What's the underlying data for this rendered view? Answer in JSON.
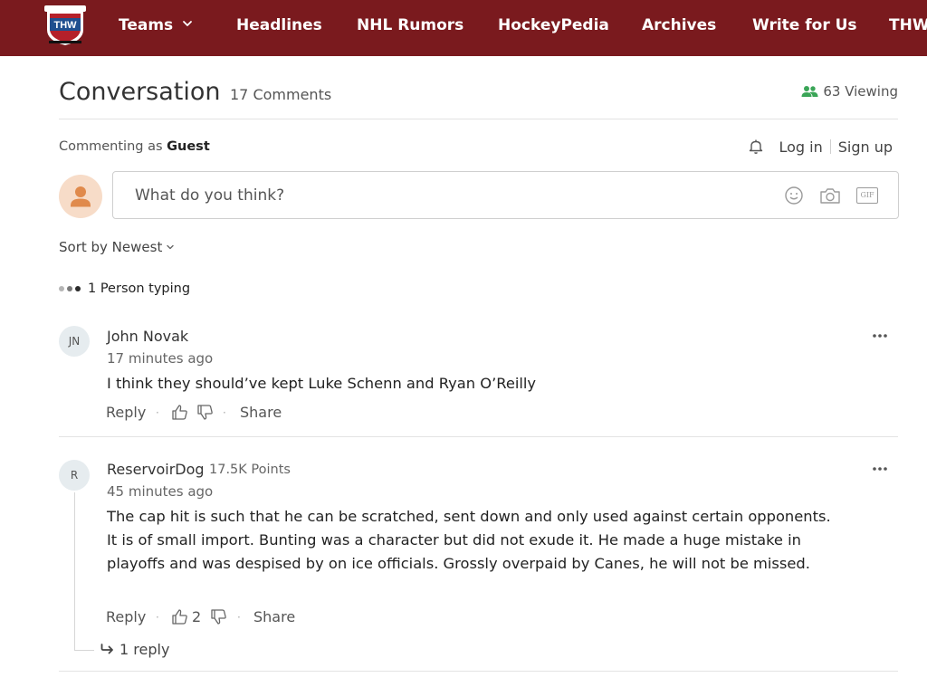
{
  "nav": {
    "items": [
      "Teams",
      "Headlines",
      "NHL Rumors",
      "HockeyPedia",
      "Archives",
      "Write for Us",
      "THW"
    ],
    "logo_text": "THW",
    "background": "#7a1a1e"
  },
  "conversation": {
    "title": "Conversation",
    "count_label": "17 Comments",
    "viewing_label": "63 Viewing"
  },
  "account": {
    "commenting_as_label": "Commenting as",
    "commenting_as_name": "Guest",
    "login_label": "Log in",
    "signup_label": "Sign up"
  },
  "composer": {
    "placeholder": "What do you think?",
    "gif_label": "GIF"
  },
  "sort": {
    "label": "Sort by Newest"
  },
  "typing": {
    "label": "1 Person typing"
  },
  "comments": [
    {
      "initials": "JN",
      "author": "John Novak",
      "points": "",
      "time": "17 minutes ago",
      "body": "I think they should’ve kept Luke Schenn and Ryan O’Reilly",
      "reply_label": "Reply",
      "share_label": "Share",
      "upvotes": ""
    },
    {
      "initials": "R",
      "author": "ReservoirDog",
      "points": "17.5K Points",
      "time": "45 minutes ago",
      "body": "The cap hit is such that he can be scratched, sent down and only used against certain opponents. It is of small import. Bunting was a character but did not exude it. He made a huge mistake in playoffs and was despised by on ice officials. Grossly overpaid by Canes, he will not be missed.",
      "reply_label": "Reply",
      "share_label": "Share",
      "upvotes": "2",
      "replies_label": "1 reply"
    }
  ],
  "icons": {
    "logo": "thw-shield-logo",
    "teams_dropdown": "chevron-down-icon",
    "viewing": "users-icon",
    "bell": "bell-icon",
    "guest_avatar": "user-icon",
    "emoji": "smiley-icon",
    "camera": "camera-icon",
    "gif": "gif-icon",
    "sort_chevron": "chevron-down-icon",
    "like": "thumbs-up-icon",
    "dislike": "thumbs-down-icon",
    "more": "ellipsis-icon",
    "reply_arrow": "reply-arrow-icon"
  },
  "colors": {
    "nav": "#7a1a1e",
    "viewing_icon": "#3aa557",
    "guest_avatar_bg": "#f7dcc8",
    "guest_avatar_fg": "#e08a4c"
  }
}
